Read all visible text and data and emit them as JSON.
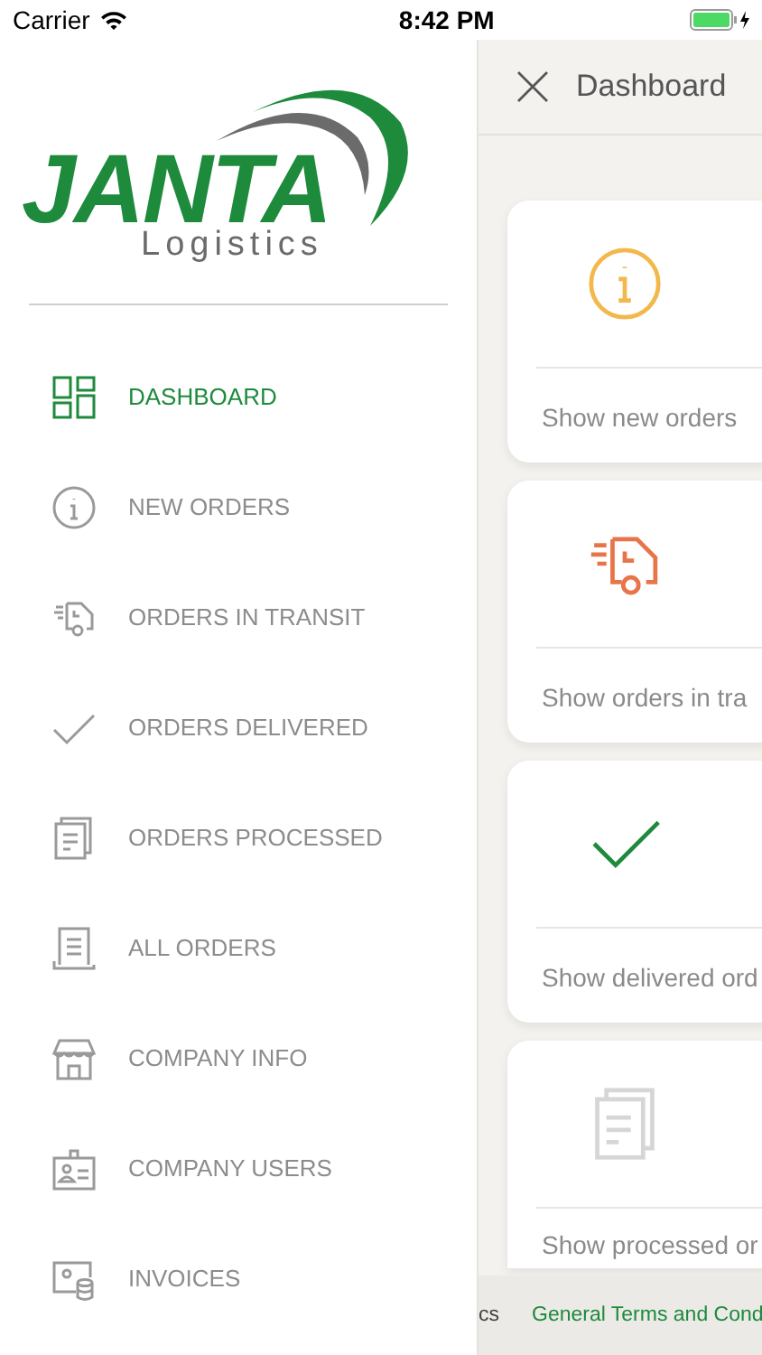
{
  "status_bar": {
    "carrier": "Carrier",
    "time": "8:42 PM"
  },
  "logo": {
    "name": "JANTA",
    "tagline": "Logistics"
  },
  "sidebar": {
    "items": [
      {
        "label": "DASHBOARD",
        "selected": true
      },
      {
        "label": "NEW ORDERS",
        "selected": false
      },
      {
        "label": "ORDERS IN TRANSIT",
        "selected": false
      },
      {
        "label": "ORDERS DELIVERED",
        "selected": false
      },
      {
        "label": "ORDERS PROCESSED",
        "selected": false
      },
      {
        "label": "ALL ORDERS",
        "selected": false
      },
      {
        "label": "COMPANY INFO",
        "selected": false
      },
      {
        "label": "COMPANY USERS",
        "selected": false
      },
      {
        "label": "INVOICES",
        "selected": false
      }
    ]
  },
  "header": {
    "title": "Dashboard"
  },
  "cards": [
    {
      "label": "Show new orders",
      "color": "#f2b84b"
    },
    {
      "label": "Show orders in tra",
      "color": "#e8744a"
    },
    {
      "label": "Show delivered ord",
      "color": "#1e8a3c"
    },
    {
      "label": "Show processed or",
      "color": "#d6d6d6"
    }
  ],
  "footer": {
    "links": [
      {
        "label": "cs",
        "selected": false
      },
      {
        "label": "General Terms and Cond",
        "selected": true
      }
    ]
  }
}
